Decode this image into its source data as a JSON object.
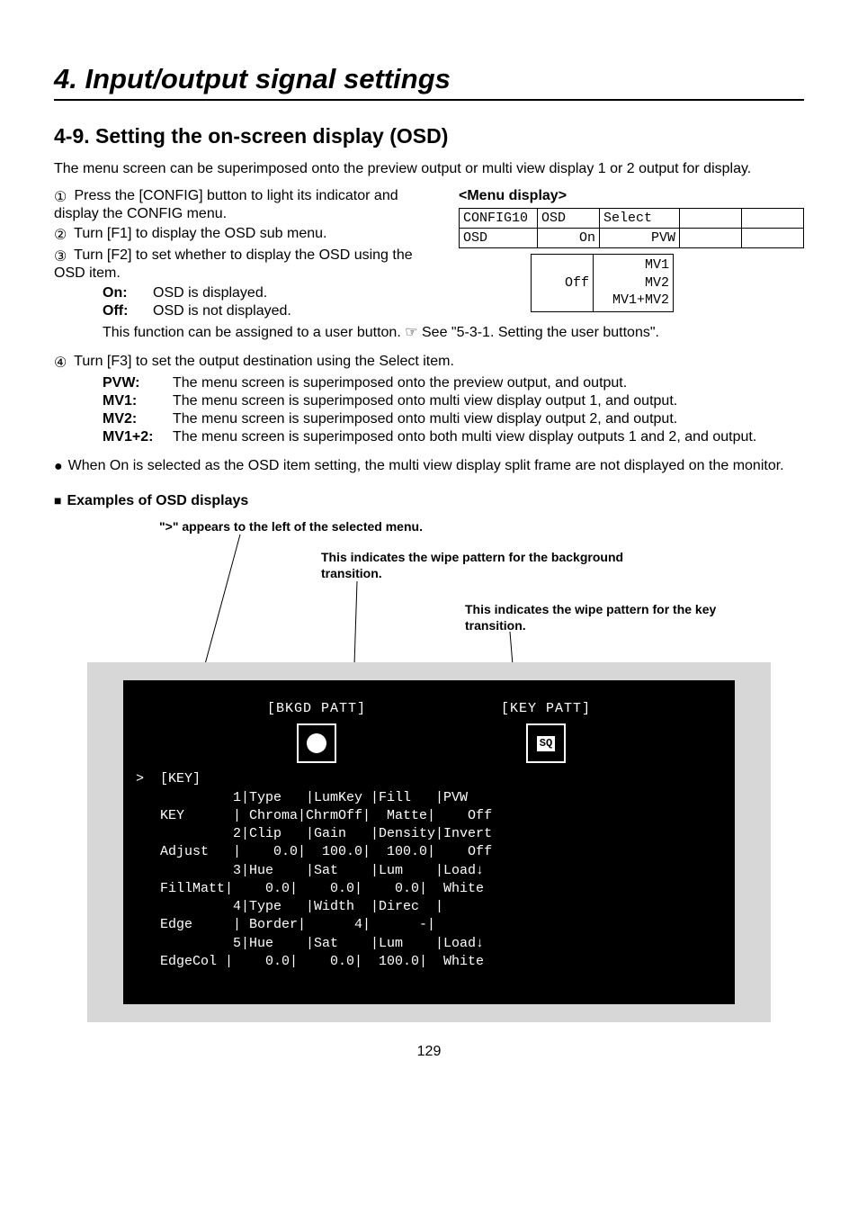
{
  "chapter_title": "4. Input/output signal settings",
  "section_title": "4-9. Setting the on-screen display (OSD)",
  "intro": "The menu screen can be superimposed onto the preview output or multi view display 1 or 2 output for display.",
  "steps": {
    "s1_num": "①",
    "s1": "Press the [CONFIG] button to light its indicator and display the CONFIG menu.",
    "s2_num": "②",
    "s2": "Turn [F1] to display the OSD sub menu.",
    "s3_num": "③",
    "s3": "Turn [F2] to set whether to display the OSD using the OSD item.",
    "on_label": "On:",
    "on_desc": "OSD is displayed.",
    "off_label": "Off:",
    "off_desc": "OSD is not displayed.",
    "fn_note": "This function can be assigned to a user button. ☞ See \"5-3-1. Setting the user buttons\".",
    "s4_num": "④",
    "s4": "Turn [F3] to set the output destination using the Select item.",
    "pvw_label": "PVW:",
    "pvw_desc": "The menu screen is superimposed onto the preview output, and output.",
    "mv1_label": "MV1:",
    "mv1_desc": "The menu screen is superimposed onto multi view display output 1, and output.",
    "mv2_label": "MV2:",
    "mv2_desc": "The menu screen is superimposed onto multi view display output 2, and output.",
    "mv12_label": "MV1+2:",
    "mv12_desc": "The menu screen is superimposed onto both multi view display outputs 1 and 2, and output."
  },
  "bullet_text": "When On is selected as the OSD item setting, the multi view display split frame are not displayed on the monitor.",
  "examples_heading": "Examples of OSD displays",
  "menu_display": {
    "heading": "<Menu display>",
    "row1": {
      "c1": "CONFIG10",
      "c2": "OSD",
      "c3": "Select"
    },
    "row2": {
      "c1": "OSD",
      "c2": "On",
      "c3": "PVW"
    },
    "sub": {
      "c2": "Off",
      "c3a": "MV1",
      "c3b": "MV2",
      "c3c": "MV1+MV2"
    }
  },
  "annotations": {
    "a1": "\">\" appears to the left of the selected menu.",
    "a2": "This indicates the wipe pattern for the background transition.",
    "a3": "This indicates the wipe pattern for the key transition."
  },
  "osd": {
    "bkgd_label": "[BKGD PATT]",
    "key_label": "[KEY PATT]",
    "sq_text": "SQ",
    "menu_text": ">  [KEY]\n            1|Type   |LumKey |Fill   |PVW\n   KEY      | Chroma|ChrmOff|  Matte|    Off\n            2|Clip   |Gain   |Density|Invert\n   Adjust   |    0.0|  100.0|  100.0|    Off\n            3|Hue    |Sat    |Lum    |Load↓\n   FillMatt|    0.0|    0.0|    0.0|  White\n            4|Type   |Width  |Direc  |\n   Edge     | Border|      4|      -|\n            5|Hue    |Sat    |Lum    |Load↓\n   EdgeCol |    0.0|    0.0|  100.0|  White"
  },
  "page_number": "129"
}
